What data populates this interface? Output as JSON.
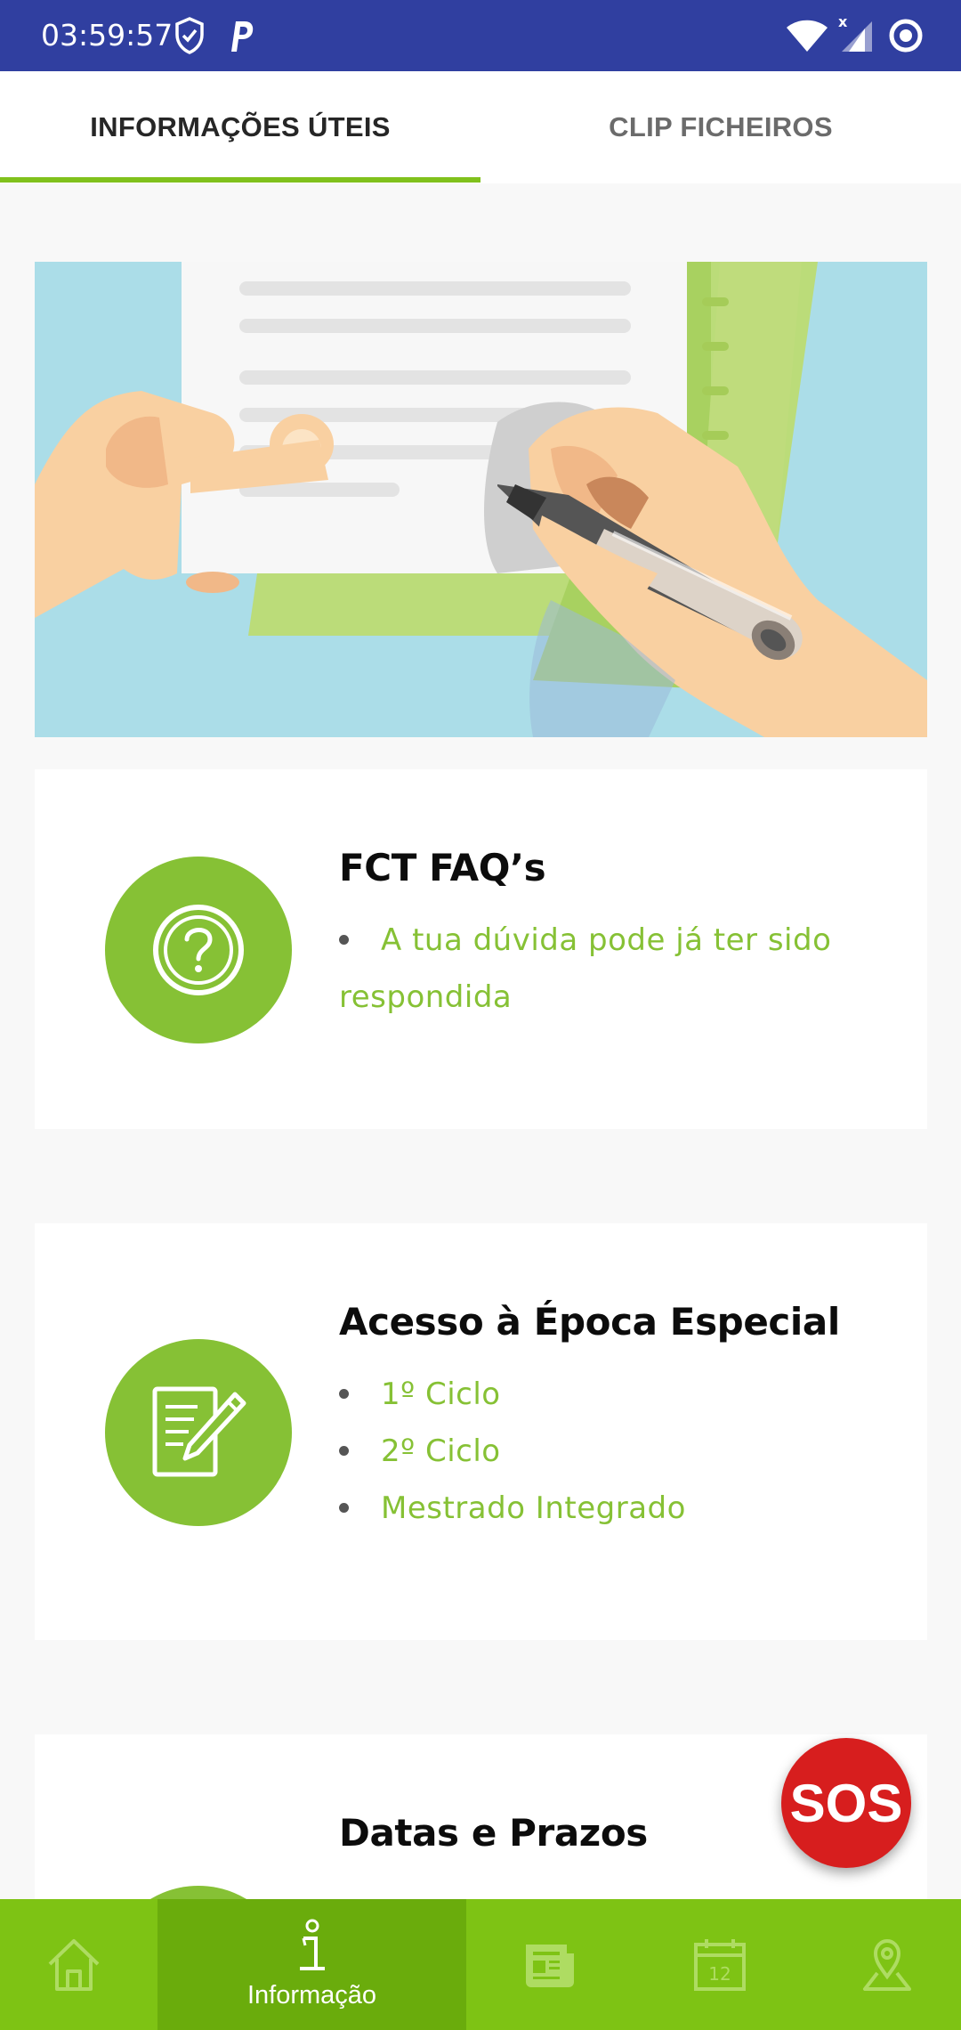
{
  "status_bar": {
    "time": "03:59:57",
    "icons": [
      "shield-icon",
      "p-app-icon",
      "wifi-icon",
      "signal-icon",
      "target-icon"
    ]
  },
  "tabs": [
    {
      "label": "INFORMAÇÕES ÚTEIS",
      "active": true
    },
    {
      "label": "CLIP FICHEIROS",
      "active": false
    }
  ],
  "cards": [
    {
      "title": "FCT FAQ’s",
      "icon": "question-icon",
      "items": [
        "A tua dúvida pode já ter sido respondida"
      ]
    },
    {
      "title": "Acesso à Época Especial",
      "icon": "document-pencil-icon",
      "items": [
        "1º Ciclo",
        "2º Ciclo",
        "Mestrado Integrado"
      ]
    },
    {
      "title": "Datas e Prazos",
      "icon": "calendar-icon",
      "items": []
    }
  ],
  "sos_label": "SOS",
  "bottom_nav": [
    {
      "icon": "home-icon",
      "label": ""
    },
    {
      "icon": "info-icon",
      "label": "Informação",
      "active": true
    },
    {
      "icon": "news-icon",
      "label": ""
    },
    {
      "icon": "calendar-icon",
      "label": "",
      "calendar_day": "12"
    },
    {
      "icon": "map-pin-icon",
      "label": ""
    }
  ],
  "colors": {
    "status_bar": "#303fa0",
    "accent_green": "#80c11c",
    "nav_active": "#6aac0c",
    "sos_red": "#d71e1e"
  }
}
